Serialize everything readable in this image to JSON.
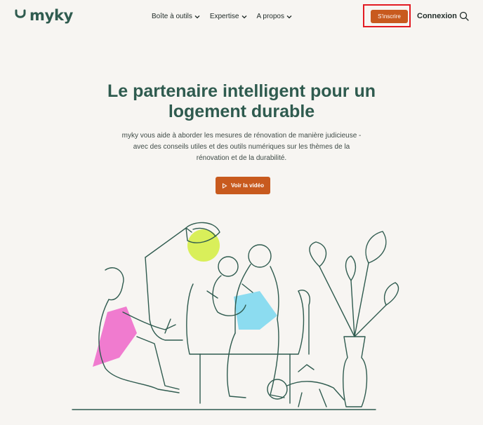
{
  "header": {
    "logo_text": "myky",
    "nav": [
      {
        "label": "Boîte à outils"
      },
      {
        "label": "Expertise"
      },
      {
        "label": "A propos"
      }
    ],
    "signup_label": "S'inscrire",
    "login_label": "Connexion",
    "icons": {
      "search": "search-icon",
      "chevron": "chevron-down-icon"
    }
  },
  "hero": {
    "title": "Le partenaire intelligent pour un logement durable",
    "subtitle": "myky vous aide à aborder les mesures de rénovation de manière judicieuse - avec des conseils utiles et des outils numériques sur les thèmes de la rénovation et de la durabilité.",
    "video_label": "Voir la vidéo",
    "video_icon": "play-icon"
  },
  "colors": {
    "brand": "#2f5b4f",
    "accent": "#c85a1e",
    "background": "#f7f5f2",
    "highlight_frame": "#e31b23"
  }
}
